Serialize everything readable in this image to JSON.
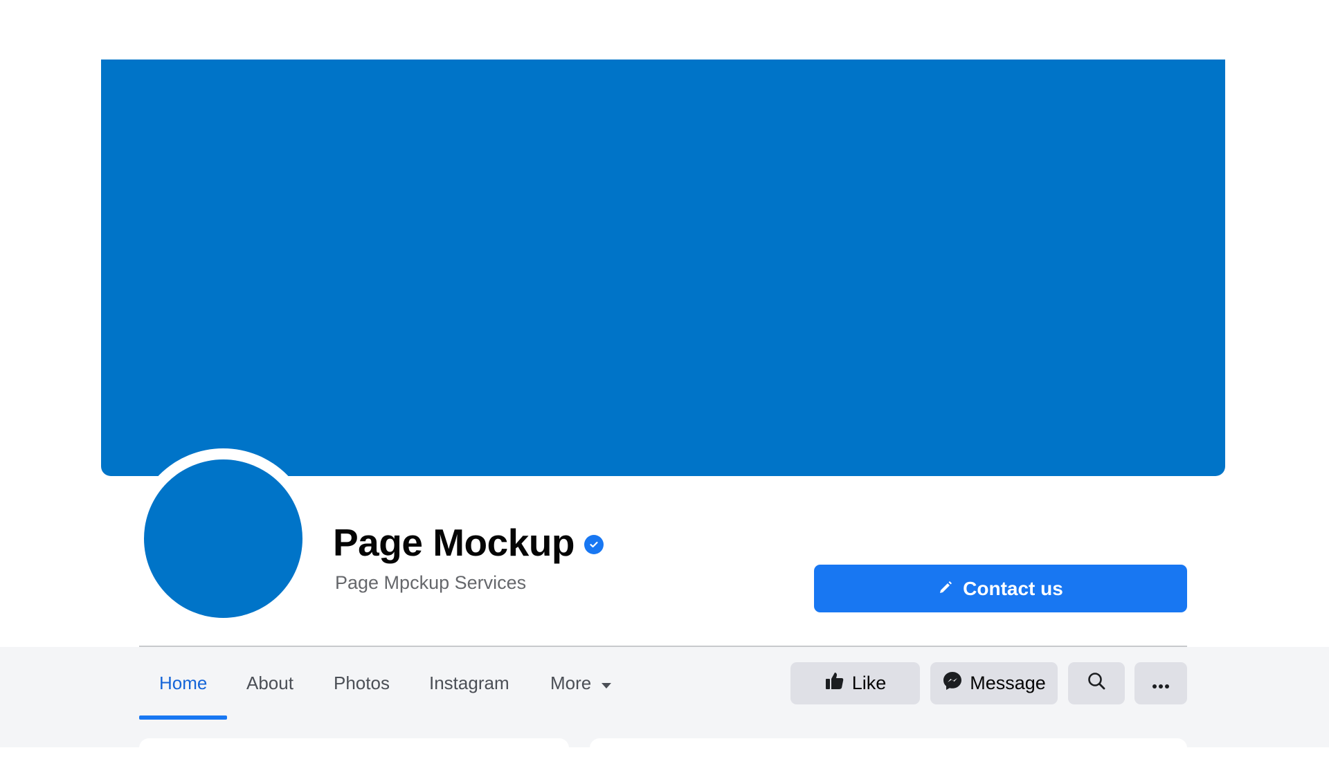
{
  "page": {
    "name": "Page Mockup",
    "subtitle": "Page Mpckup Services",
    "verified": true,
    "cover_color": "#0074c8",
    "accent_color": "#1877f2"
  },
  "primary_action": {
    "label": "Contact us",
    "icon": "pencil-icon"
  },
  "tabs": [
    {
      "label": "Home",
      "active": true
    },
    {
      "label": "About",
      "active": false
    },
    {
      "label": "Photos",
      "active": false
    },
    {
      "label": "Instagram",
      "active": false
    },
    {
      "label": "More",
      "active": false,
      "icon": "caret-down-icon"
    }
  ],
  "actions": [
    {
      "label": "Like",
      "icon": "thumbs-up-icon"
    },
    {
      "label": "Message",
      "icon": "messenger-icon"
    },
    {
      "label": "",
      "icon": "search-icon"
    },
    {
      "label": "",
      "icon": "more-dots-icon"
    }
  ]
}
